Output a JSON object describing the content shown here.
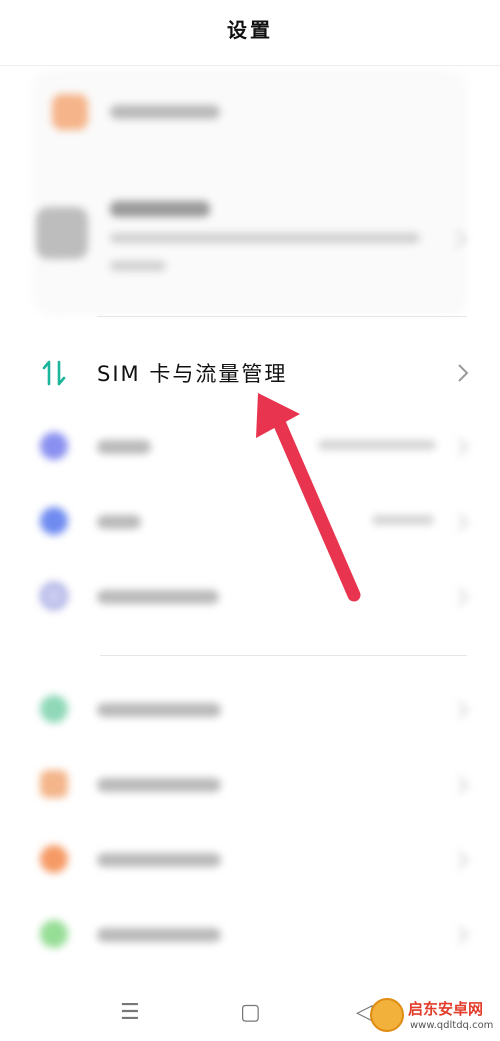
{
  "header": {
    "title": "设置"
  },
  "sim_item": {
    "label": "SIM 卡与流量管理",
    "icon": "sim-data-arrows-icon"
  },
  "colors": {
    "accent_teal": "#1bb59b",
    "arrow_red": "#e8344e",
    "watermark_red": "#e23c2b"
  },
  "blurred_rows": [
    {
      "icon_color": "#8a90f0",
      "icon": "wifi-icon"
    },
    {
      "icon_color": "#6f8bf0",
      "icon": "bluetooth-icon"
    },
    {
      "icon_color": "#9a9cdd",
      "icon": "connection-icon"
    },
    {
      "icon_color": "#8fd8b8",
      "icon": "wallpaper-icon"
    },
    {
      "icon_color": "#f4b58a",
      "icon": "notification-icon"
    },
    {
      "icon_color": "#f59a65",
      "icon": "display-icon"
    },
    {
      "icon_color": "#96dd96",
      "icon": "sound-icon"
    }
  ],
  "navbar": {
    "menu_icon": "☰",
    "home_icon": "▢",
    "back_icon": "◁"
  },
  "watermark": {
    "title": "启东安卓网",
    "url": "www.qdltdq.com"
  }
}
